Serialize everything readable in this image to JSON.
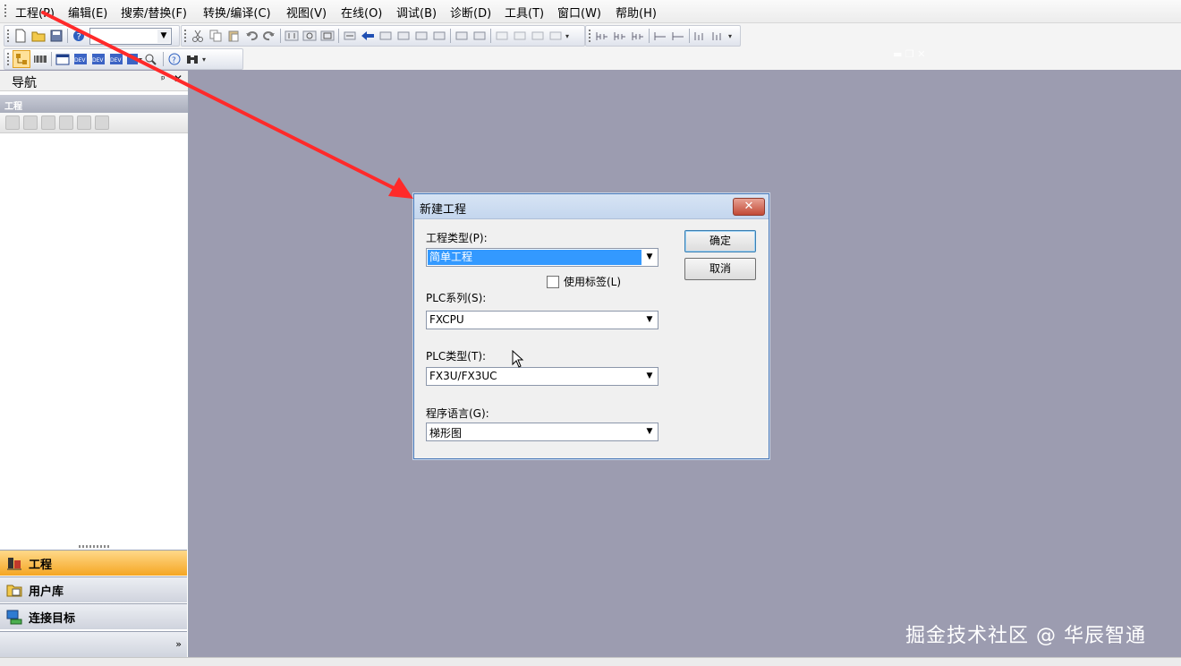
{
  "menubar": {
    "items": [
      "工程(P)",
      "编辑(E)",
      "搜索/替换(F)",
      "转换/编译(C)",
      "视图(V)",
      "在线(O)",
      "调试(B)",
      "诊断(D)",
      "工具(T)",
      "窗口(W)",
      "帮助(H)"
    ]
  },
  "toolbar": {
    "icons": [
      "new-file-icon",
      "open-folder-icon",
      "save-icon",
      "help-icon",
      "cut-icon",
      "copy-icon",
      "paste-icon",
      "undo-icon",
      "redo-icon",
      "project-view-icon",
      "device-icon",
      "zoom-icon",
      "search-icon",
      "binoculars-icon"
    ]
  },
  "nav": {
    "title": "导航",
    "section": "工程",
    "tabs": [
      {
        "label": "工程",
        "active": true,
        "icon": "project-icon"
      },
      {
        "label": "用户库",
        "active": false,
        "icon": "user-library-icon"
      },
      {
        "label": "连接目标",
        "active": false,
        "icon": "connection-icon"
      }
    ]
  },
  "dialog": {
    "title": "新建工程",
    "close_label": "✕",
    "project_type_label": "工程类型(P):",
    "project_type_value": "简单工程",
    "use_label_text": "使用标签(L)",
    "use_label_checked": false,
    "plc_series_label": "PLC系列(S):",
    "plc_series_value": "FXCPU",
    "plc_type_label": "PLC类型(T):",
    "plc_type_value": "FX3U/FX3UC",
    "program_lang_label": "程序语言(G):",
    "program_lang_value": "梯形图",
    "ok_label": "确定",
    "cancel_label": "取消"
  },
  "watermark": "掘金技术社区 @ 华辰智通",
  "colors": {
    "workspace": "#9c9cb0",
    "arrow": "#ff2a2a",
    "selection": "#3399ff",
    "active_tab": "#f5a623"
  }
}
